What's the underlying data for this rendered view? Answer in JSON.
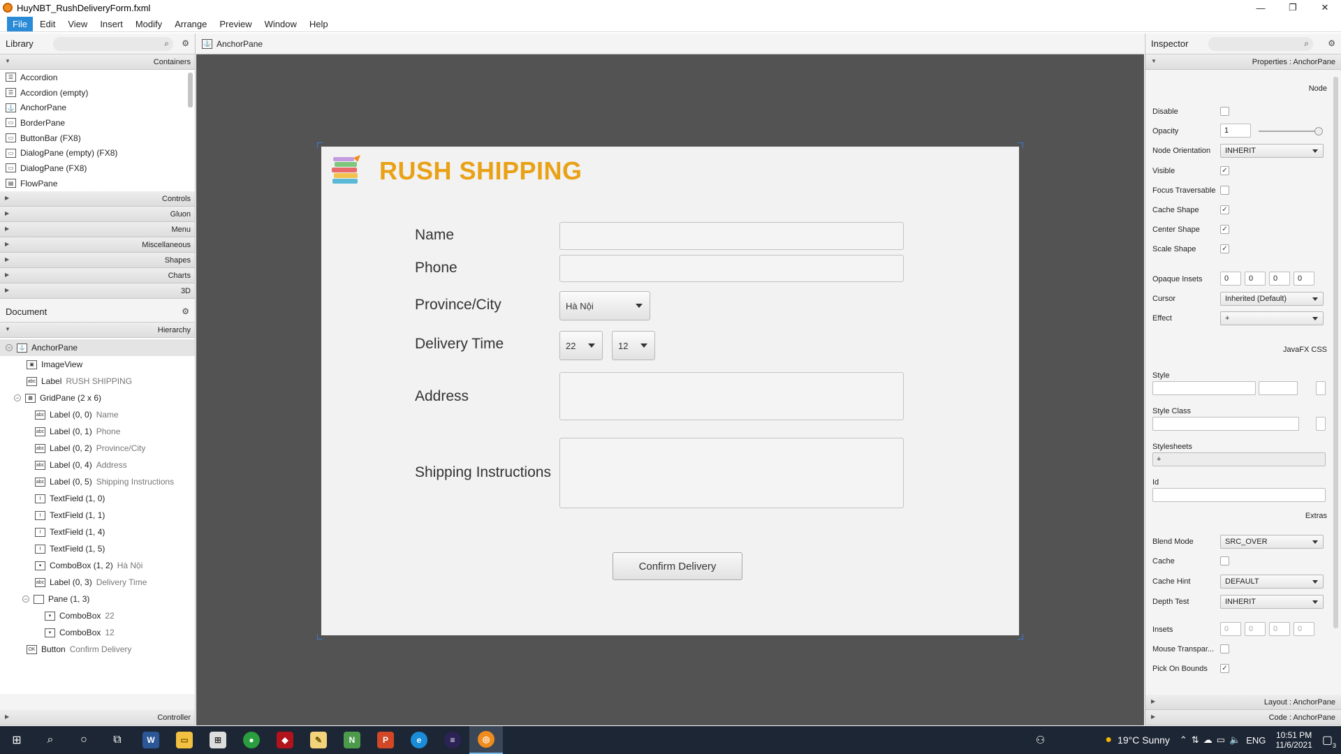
{
  "window": {
    "title": "HuyNBT_RushDeliveryForm.fxml",
    "controls": [
      "—",
      "❐",
      "✕"
    ]
  },
  "menubar": {
    "items": [
      "File",
      "Edit",
      "View",
      "Insert",
      "Modify",
      "Arrange",
      "Preview",
      "Window",
      "Help"
    ],
    "active": "File"
  },
  "library": {
    "title": "Library",
    "sections_open": "Containers",
    "items": [
      "Accordion",
      "Accordion  (empty)",
      "AnchorPane",
      "BorderPane",
      "ButtonBar  (FX8)",
      "DialogPane (empty)  (FX8)",
      "DialogPane  (FX8)",
      "FlowPane"
    ],
    "sections_closed": [
      "Controls",
      "Gluon",
      "Menu",
      "Miscellaneous",
      "Shapes",
      "Charts",
      "3D"
    ]
  },
  "document": {
    "title": "Document",
    "section": "Hierarchy",
    "tree": [
      {
        "label": "AnchorPane",
        "extra": ""
      },
      {
        "label": "ImageView",
        "extra": ""
      },
      {
        "label": "Label",
        "extra": "RUSH SHIPPING"
      },
      {
        "label": "GridPane (2 x 6)",
        "extra": ""
      },
      {
        "label": "Label (0, 0)",
        "extra": "Name"
      },
      {
        "label": "Label (0, 1)",
        "extra": "Phone"
      },
      {
        "label": "Label (0, 2)",
        "extra": "Province/City"
      },
      {
        "label": "Label (0, 4)",
        "extra": "Address"
      },
      {
        "label": "Label (0, 5)",
        "extra": "Shipping Instructions"
      },
      {
        "label": "TextField (1, 0)",
        "extra": ""
      },
      {
        "label": "TextField (1, 1)",
        "extra": ""
      },
      {
        "label": "TextField (1, 4)",
        "extra": ""
      },
      {
        "label": "TextField (1, 5)",
        "extra": ""
      },
      {
        "label": "ComboBox (1, 2)",
        "extra": "Hà Nội"
      },
      {
        "label": "Label (0, 3)",
        "extra": "Delivery Time"
      },
      {
        "label": "Pane (1, 3)",
        "extra": ""
      },
      {
        "label": "ComboBox",
        "extra": "22"
      },
      {
        "label": "ComboBox",
        "extra": "12"
      },
      {
        "label": "Button",
        "extra": "Confirm Delivery"
      }
    ],
    "footer": "Controller"
  },
  "breadcrumb": {
    "label": "AnchorPane"
  },
  "form": {
    "title": "RUSH SHIPPING",
    "labels": {
      "name": "Name",
      "phone": "Phone",
      "province": "Province/City",
      "delivery_time": "Delivery Time",
      "address": "Address",
      "instructions": "Shipping Instructions"
    },
    "fields": {
      "name": "",
      "phone": "",
      "address": "",
      "instructions": ""
    },
    "province_value": "Hà Nội",
    "hour_value": "22",
    "minute_value": "12",
    "confirm_label": "Confirm Delivery"
  },
  "inspector": {
    "title": "Inspector",
    "properties_header": "Properties : AnchorPane",
    "node_header": "Node",
    "disable": "Disable",
    "opacity_label": "Opacity",
    "opacity_value": "1",
    "node_orientation_label": "Node Orientation",
    "node_orientation_value": "INHERIT",
    "visible": "Visible",
    "focus_traversable": "Focus Traversable",
    "cache_shape": "Cache Shape",
    "center_shape": "Center Shape",
    "scale_shape": "Scale Shape",
    "opaque_insets_label": "Opaque Insets",
    "opaque_insets": [
      "0",
      "0",
      "0",
      "0"
    ],
    "cursor_label": "Cursor",
    "cursor_value": "Inherited (Default)",
    "effect_label": "Effect",
    "effect_value": "+",
    "css_header": "JavaFX CSS",
    "style_label": "Style",
    "style_class_label": "Style Class",
    "stylesheets_label": "Stylesheets",
    "stylesheets_value": "+",
    "id_label": "Id",
    "extras_header": "Extras",
    "blend_mode_label": "Blend Mode",
    "blend_mode_value": "SRC_OVER",
    "cache_label": "Cache",
    "cache_hint_label": "Cache Hint",
    "cache_hint_value": "DEFAULT",
    "depth_test_label": "Depth Test",
    "depth_test_value": "INHERIT",
    "insets_label": "Insets",
    "insets": [
      "0",
      "0",
      "0",
      "0"
    ],
    "mouse_transparent": "Mouse Transpar...",
    "pick_on_bounds": "Pick On Bounds",
    "layout_header": "Layout : AnchorPane",
    "code_header": "Code : AnchorPane"
  },
  "taskbar": {
    "weather": "19°C  Sunny",
    "lang": "ENG",
    "time": "10:51 PM",
    "date": "11/6/2021",
    "notifications": "3"
  }
}
